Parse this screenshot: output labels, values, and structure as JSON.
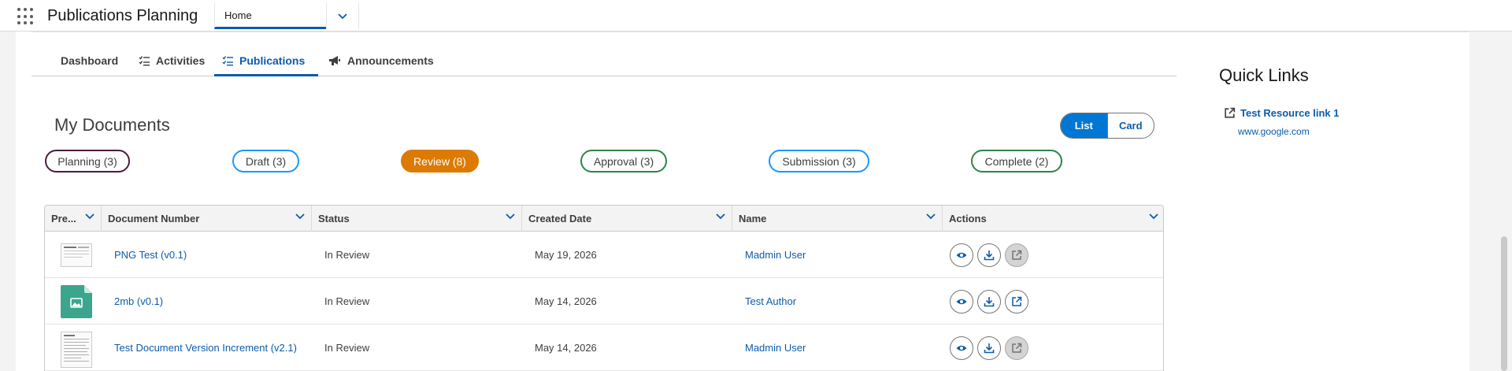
{
  "app": {
    "name": "Publications Planning"
  },
  "nav": {
    "current_tab": "Home"
  },
  "tabs": [
    {
      "label": "Dashboard",
      "icon": "none",
      "active": false
    },
    {
      "label": "Activities",
      "icon": "task-list-icon",
      "active": false
    },
    {
      "label": "Publications",
      "icon": "task-list-icon",
      "active": true
    },
    {
      "label": "Announcements",
      "icon": "megaphone-icon",
      "active": false
    }
  ],
  "documents": {
    "title": "My Documents",
    "view_toggle": {
      "list": "List",
      "card": "Card",
      "selected": "List"
    },
    "statuses": [
      {
        "label": "Planning (3)",
        "border": "#4a1c40",
        "fill": "#ffffff",
        "text": "#3e3e3c"
      },
      {
        "label": "Draft (3)",
        "border": "#1b96ff",
        "fill": "#ffffff",
        "text": "#3e3e3c"
      },
      {
        "label": "Review (8)",
        "border": "#dd7a01",
        "fill": "#dd7a01",
        "text": "#ffffff"
      },
      {
        "label": "Approval (3)",
        "border": "#2e844a",
        "fill": "#ffffff",
        "text": "#3e3e3c"
      },
      {
        "label": "Submission (3)",
        "border": "#1b96ff",
        "fill": "#ffffff",
        "text": "#3e3e3c"
      },
      {
        "label": "Complete (2)",
        "border": "#2e844a",
        "fill": "#ffffff",
        "text": "#3e3e3c"
      }
    ],
    "columns": [
      "Pre...",
      "Document Number",
      "Status",
      "Created Date",
      "Name",
      "Actions"
    ],
    "rows": [
      {
        "preview": "doc-thumbnail",
        "document_number": "PNG Test (v0.1)",
        "status": "In Review",
        "created_date": "May 19, 2026",
        "name": "Madmin User",
        "open_enabled": false
      },
      {
        "preview": "image-file-icon",
        "document_number": "2mb (v0.1)",
        "status": "In Review",
        "created_date": "May 14, 2026",
        "name": "Test Author",
        "open_enabled": true
      },
      {
        "preview": "doc-thumbnail",
        "document_number": "Test Document Version Increment (v2.1)",
        "status": "In Review",
        "created_date": "May 14, 2026",
        "name": "Madmin User",
        "open_enabled": false
      }
    ]
  },
  "quick_links": {
    "title": "Quick Links",
    "items": [
      {
        "label": "Test Resource link 1",
        "url": "www.google.com",
        "icon": "external-link-icon"
      }
    ]
  },
  "colors": {
    "brand": "#0176d3",
    "link": "#0b5cab",
    "review": "#dd7a01"
  }
}
